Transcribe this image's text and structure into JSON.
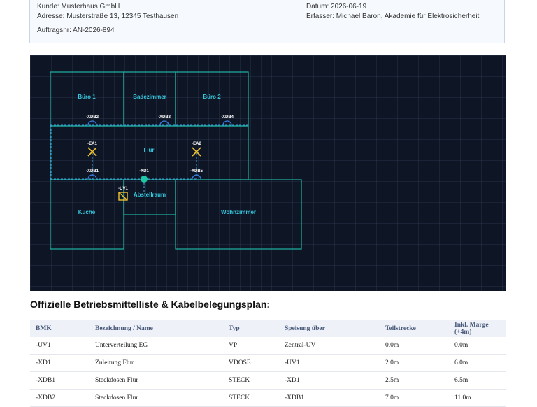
{
  "header": {
    "kunde": "Kunde: Musterhaus GmbH",
    "adresse": "Adresse: Musterstraße 13, 12345 Testhausen",
    "auftrag": "Auftragsnr: AN-2026-894",
    "datum": "Datum: 2026-06-19",
    "erfasser": "Erfasser: Michael Baron, Akademie für Elektrosicherheit"
  },
  "plan": {
    "colors": {
      "background": "#0e1524",
      "walls": "#1fa89a",
      "room_label": "#35c7dd",
      "cable": "#3aa0e0",
      "socket": "#3a7de0",
      "light": "#f1c232",
      "box": "#1fc7a8"
    },
    "rooms": {
      "buero1": "Büro 1",
      "bad": "Badezimmer",
      "buero2": "Büro 2",
      "flur": "Flur",
      "abstell": "Abstellraum",
      "kueche": "Küche",
      "wohn": "Wohnzimmer"
    },
    "devices": {
      "xdb2": "-XDB2",
      "xdb3": "-XDB3",
      "xdb4": "-XDB4",
      "ea1": "-EA1",
      "ea2": "-EA2",
      "xdb1": "-XDB1",
      "xd1": "-XD1",
      "xdb5": "-XDB5",
      "uv1": "-UV1"
    }
  },
  "table": {
    "title": "Offizielle Betriebsmittelliste & Kabelbelegungsplan:",
    "headers": [
      "BMK",
      "Bezeichnung / Name",
      "Typ",
      "Speisung über",
      "Teilstrecke",
      "Inkl. Marge (+4m)"
    ],
    "rows": [
      [
        "-UV1",
        "Unterverteilung EG",
        "VP",
        "Zentral-UV",
        "0.0m",
        "0.0m"
      ],
      [
        "-XD1",
        "Zuleitung Flur",
        "VDOSE",
        "-UV1",
        "2.0m",
        "6.0m"
      ],
      [
        "-XDB1",
        "Steckdosen Flur",
        "STECK",
        "-XD1",
        "2.5m",
        "6.5m"
      ],
      [
        "-XDB2",
        "Steckdosen Flur",
        "STECK",
        "-XDB1",
        "7.0m",
        "11.0m"
      ]
    ]
  }
}
